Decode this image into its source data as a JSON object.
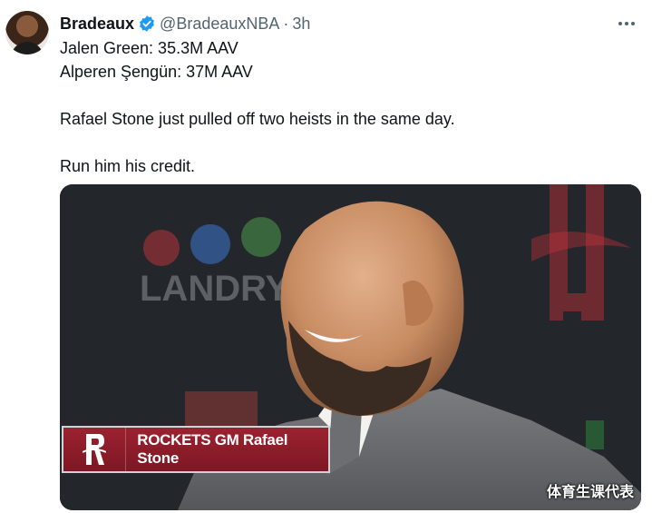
{
  "tweet": {
    "display_name": "Bradeaux",
    "handle": "@BradeauxNBA",
    "separator": "·",
    "time": "3h",
    "verified_icon": "verified-badge-icon",
    "more_icon": "more-icon",
    "lines": [
      "Jalen Green: 35.3M AAV",
      "Alperen Şengün: 37M AAV",
      "Rafael Stone just pulled off two heists in the same day.",
      "Run him his credit."
    ]
  },
  "media": {
    "backdrop_text": "LANDRY",
    "lower_third": "ROCKETS GM Rafael Stone",
    "logo_icon": "rockets-logo-icon"
  },
  "watermark": "体育生课代表",
  "colors": {
    "verified": "#1d9bf0",
    "rockets_red": "#ce1141",
    "muted": "#536471"
  }
}
